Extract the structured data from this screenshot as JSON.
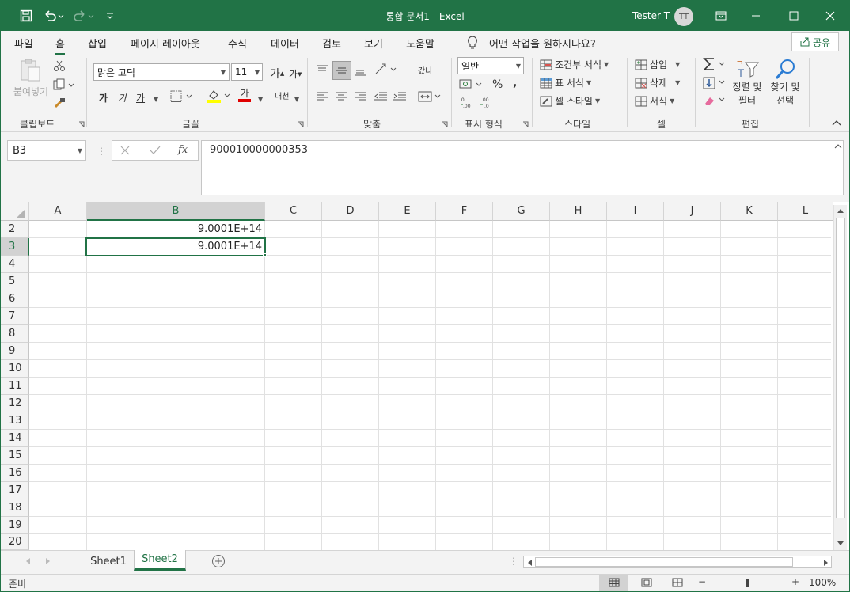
{
  "window": {
    "title": "통합 문서1  -  Excel",
    "user": "Tester T",
    "avatar": "TT",
    "colors": {
      "accent": "#217346",
      "ribbon_bg": "#f3f3f3"
    }
  },
  "menu": {
    "tabs": [
      "파일",
      "홈",
      "삽입",
      "페이지 레이아웃",
      "수식",
      "데이터",
      "검토",
      "보기",
      "도움말"
    ],
    "active": "홈",
    "tell_me": "어떤 작업을 원하시나요?",
    "share": "공유"
  },
  "ribbon": {
    "clipboard": {
      "paste": "붙여넣기",
      "label": "클립보드"
    },
    "font": {
      "name": "맑은 고딕",
      "size": "11",
      "grow": "가",
      "shrink": "가",
      "bold": "가",
      "italic": "가",
      "underline": "가",
      "font_color": "가",
      "phonetic": "내천",
      "label": "글꼴"
    },
    "alignment": {
      "wrap": "갔나",
      "label": "맞춤"
    },
    "number": {
      "format": "일반",
      "label": "표시 형식"
    },
    "styles": {
      "conditional": "조건부 서식",
      "table": "표 서식",
      "cell": "셀 스타일",
      "label": "스타일"
    },
    "cells": {
      "insert": "삽입",
      "delete": "삭제",
      "format": "서식",
      "label": "셀"
    },
    "editing": {
      "sort_line1": "정렬 및",
      "sort_line2": "필터",
      "find_line1": "찾기 및",
      "find_line2": "선택",
      "label": "편집"
    }
  },
  "formula_bar": {
    "name_box": "B3",
    "content": "900010000000353"
  },
  "grid": {
    "columns": [
      "A",
      "B",
      "C",
      "D",
      "E",
      "F",
      "G",
      "H",
      "I",
      "J",
      "K",
      "L"
    ],
    "selected_column": "B",
    "rows": [
      "2",
      "3",
      "4",
      "5",
      "6",
      "7",
      "8",
      "9",
      "10",
      "11",
      "12",
      "13",
      "14",
      "15",
      "16",
      "17",
      "18",
      "19",
      "20"
    ],
    "selected_row": "3",
    "cells": {
      "B2": "9.0001E+14",
      "B3": "9.0001E+14"
    }
  },
  "sheets": {
    "tabs": [
      "Sheet1",
      "Sheet2"
    ],
    "active": "Sheet2"
  },
  "status": {
    "mode": "준비",
    "zoom": "100%"
  }
}
